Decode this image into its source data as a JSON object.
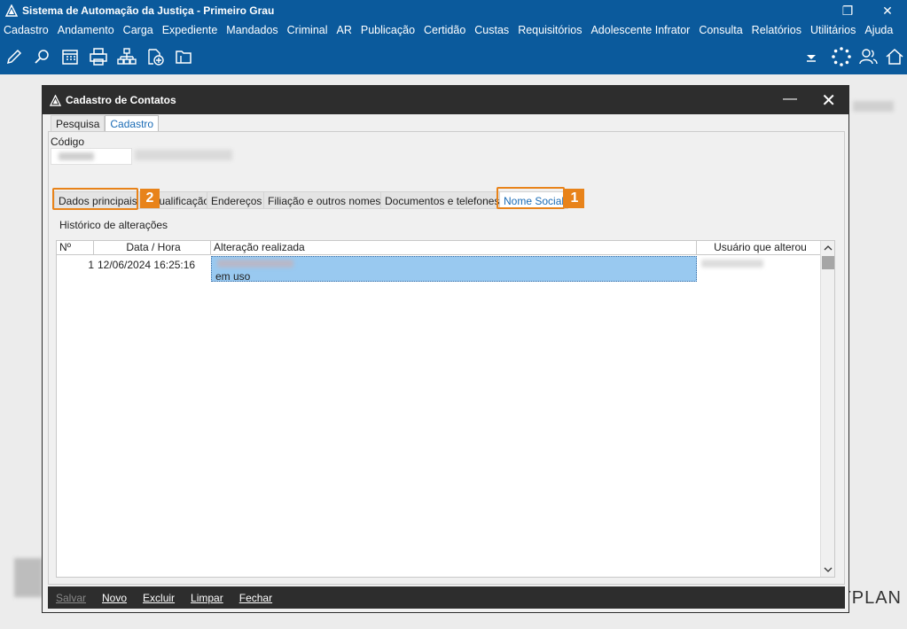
{
  "app": {
    "title": "Sistema de Automação da Justiça - Primeiro Grau",
    "restore_glyph": "❐",
    "close_glyph": "✕"
  },
  "menu": [
    "Cadastro",
    "Andamento",
    "Carga",
    "Expediente",
    "Mandados",
    "Criminal",
    "AR",
    "Publicação",
    "Certidão",
    "Custas",
    "Requisitórios",
    "Adolescente Infrator",
    "Consulta",
    "Relatórios",
    "Utilitários",
    "Ajuda"
  ],
  "toolbar_icons": [
    "edit-icon",
    "search-docs-icon",
    "calendar-icon",
    "printer-icon",
    "org-chart-icon",
    "add-file-icon",
    "folder-icon",
    "dropdown-icon",
    "loading-icon",
    "users-icon",
    "home-icon"
  ],
  "dialog": {
    "title": "Cadastro de Contatos",
    "minimize_glyph": "—",
    "close_glyph": "✕",
    "top_tabs": [
      "Pesquisa",
      "Cadastro"
    ],
    "active_top_tab": "Cadastro",
    "codigo_label": "Código",
    "sub_tabs": [
      "Dados principais",
      "Qualificação",
      "Endereços",
      "Filiação e outros nomes",
      "Documentos e telefones",
      "Nome Social"
    ],
    "active_sub_tab": "Nome Social",
    "history_title": "Histórico de alterações",
    "grid": {
      "columns": [
        "Nº",
        "Data / Hora",
        "Alteração realizada",
        "Usuário que alterou"
      ],
      "rows": [
        {
          "num": "1",
          "datetime": "12/06/2024 16:25:16",
          "change": "em uso",
          "user": ""
        }
      ]
    },
    "footer_buttons": [
      {
        "label": "Salvar",
        "enabled": false
      },
      {
        "label": "Novo",
        "enabled": true
      },
      {
        "label": "Excluir",
        "enabled": true
      },
      {
        "label": "Limpar",
        "enabled": true
      },
      {
        "label": "Fechar",
        "enabled": true
      }
    ]
  },
  "annotations": {
    "badge_1": "1",
    "badge_2": "2",
    "color": "#e8831a"
  },
  "brand_text": "TPLAN",
  "colors": {
    "app_blue": "#0b5a9c",
    "dialog_dark": "#2d2d2d",
    "selection": "#99c9f0",
    "tab_active_text": "#1a6bb5"
  }
}
